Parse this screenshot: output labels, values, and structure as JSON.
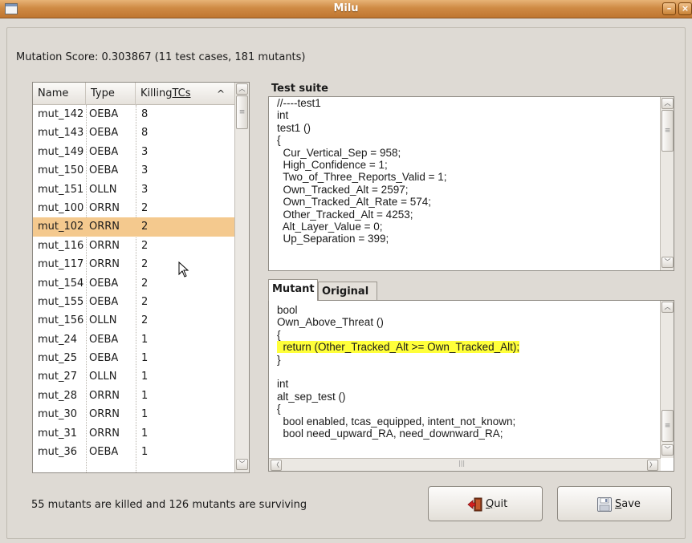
{
  "window": {
    "title": "Milu"
  },
  "summary": {
    "score_text": "Mutation Score: 0.303867 (11 test cases, 181 mutants)"
  },
  "mutant_list": {
    "columns": [
      "Name",
      "Type",
      "Killing",
      "TCs"
    ],
    "sort_indicator": "^",
    "rows": [
      [
        "mut_142",
        "OEBA",
        "8"
      ],
      [
        "mut_143",
        "OEBA",
        "8"
      ],
      [
        "mut_149",
        "OEBA",
        "3"
      ],
      [
        "mut_150",
        "OEBA",
        "3"
      ],
      [
        "mut_151",
        "OLLN",
        "3"
      ],
      [
        "mut_100",
        "ORRN",
        "2"
      ],
      [
        "mut_102",
        "ORRN",
        "2"
      ],
      [
        "mut_116",
        "ORRN",
        "2"
      ],
      [
        "mut_117",
        "ORRN",
        "2"
      ],
      [
        "mut_154",
        "OEBA",
        "2"
      ],
      [
        "mut_155",
        "OEBA",
        "2"
      ],
      [
        "mut_156",
        "OLLN",
        "2"
      ],
      [
        "mut_24",
        "OEBA",
        "1"
      ],
      [
        "mut_25",
        "OEBA",
        "1"
      ],
      [
        "mut_27",
        "OLLN",
        "1"
      ],
      [
        "mut_28",
        "ORRN",
        "1"
      ],
      [
        "mut_30",
        "ORRN",
        "1"
      ],
      [
        "mut_31",
        "ORRN",
        "1"
      ],
      [
        "mut_36",
        "OEBA",
        "1"
      ]
    ],
    "selected_index": 6
  },
  "test_suite": {
    "label": "Test suite",
    "lines": [
      "//----test1",
      "int",
      "test1 ()",
      "{",
      "  Cur_Vertical_Sep = 958;",
      "  High_Confidence = 1;",
      "  Two_of_Three_Reports_Valid = 1;",
      "  Own_Tracked_Alt = 2597;",
      "  Own_Tracked_Alt_Rate = 574;",
      "  Other_Tracked_Alt = 4253;",
      "  Alt_Layer_Value = 0;",
      "  Up_Separation = 399;"
    ]
  },
  "tabs": {
    "mutant": "Mutant",
    "original": "Original"
  },
  "mutant_code": {
    "lines": [
      "bool",
      "Own_Above_Threat ()",
      "{",
      "  return (Other_Tracked_Alt >= Own_Tracked_Alt);",
      "}",
      "",
      "int",
      "alt_sep_test ()",
      "{",
      "  bool enabled, tcas_equipped, intent_not_known;",
      "  bool need_upward_RA, need_downward_RA;"
    ],
    "highlight_line": 3,
    "highlight_color": "#ffff3a"
  },
  "status": {
    "text": "55 mutants are killed and 126 mutants are surviving"
  },
  "buttons": {
    "quit": {
      "mnemonic": "Q",
      "rest": "uit"
    },
    "save": {
      "mnemonic": "S",
      "rest": "ave"
    }
  },
  "colors": {
    "selection": "#f4c98e",
    "titlebar": "#cf8a44"
  },
  "icons": [
    "window-menu-icon",
    "minimize-icon",
    "close-icon",
    "quit-door-icon",
    "save-floppy-icon",
    "mouse-pointer-icon"
  ]
}
